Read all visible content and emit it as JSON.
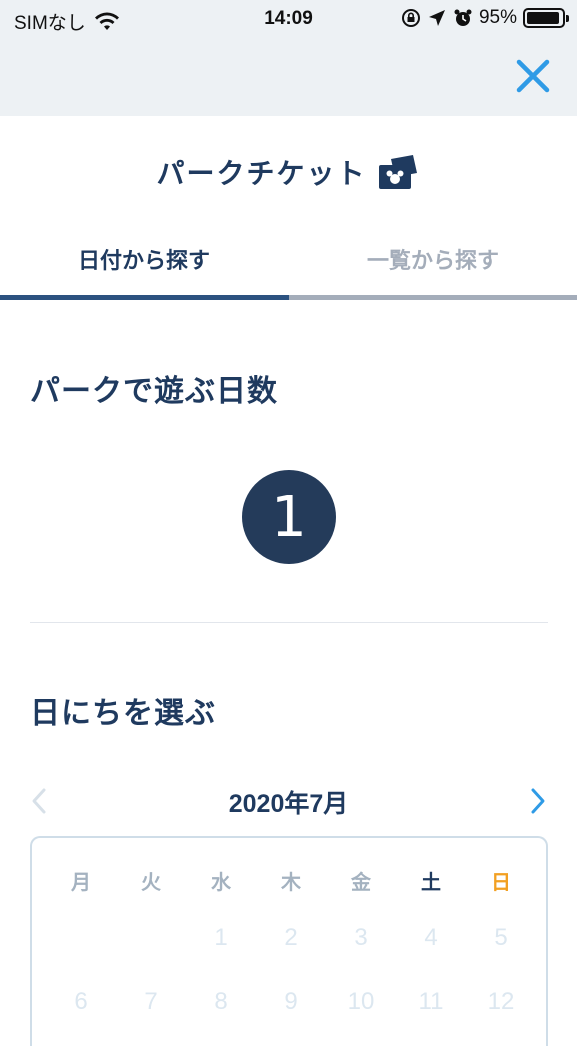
{
  "status_bar": {
    "carrier": "SIMなし",
    "time": "14:09",
    "battery": "95%",
    "battery_level": 0.95
  },
  "header": {
    "close_icon": "close-icon",
    "accent_color": "#2f9be6"
  },
  "page": {
    "title": "パークチケット",
    "title_icon": "ticket-icon"
  },
  "tabs": [
    {
      "label": "日付から探す",
      "active": true
    },
    {
      "label": "一覧から探す",
      "active": false
    }
  ],
  "days_section": {
    "title": "パークで遊ぶ日数",
    "selected_days": "1"
  },
  "date_section": {
    "title": "日にちを選ぶ",
    "month_label": "2020年7月",
    "weekdays": [
      "月",
      "火",
      "水",
      "木",
      "金",
      "土",
      "日"
    ],
    "weeks": [
      [
        "",
        "",
        "1",
        "2",
        "3",
        "4",
        "5"
      ],
      [
        "6",
        "7",
        "8",
        "9",
        "10",
        "11",
        "12"
      ]
    ]
  },
  "colors": {
    "primary": "#1f3a5f",
    "inactive": "#a4adba",
    "sunday": "#f2a022",
    "circle": "#243b5a"
  }
}
